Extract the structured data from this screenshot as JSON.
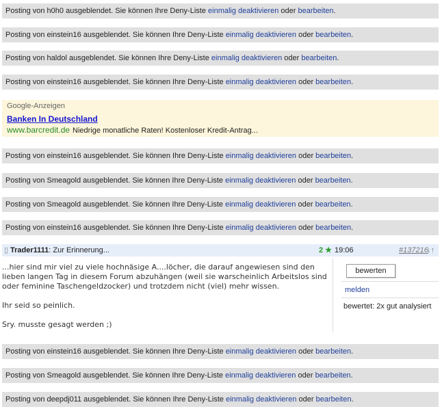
{
  "text": {
    "prefix": "Posting von ",
    "mid": " ausgeblendet. Sie können Ihre Deny-Liste ",
    "link1": "einmalig deaktivieren",
    "or": " oder ",
    "link2": "bearbeiten",
    "end": "."
  },
  "hidden_top": [
    "h0h0",
    "einstein16",
    "haldol",
    "einstein16"
  ],
  "ad": {
    "label": "Google-Anzeigen",
    "title": "Banken In Deutschland",
    "url": "www.barcredit.de",
    "desc": "Niedrige monatliche Raten! Kostenloser Kredit-Antrag..."
  },
  "hidden_mid": [
    "einstein16",
    "Smeagold",
    "Smeagold",
    "einstein16"
  ],
  "post": {
    "user": "Trader1111",
    "subject": ": Zur Erinnerung...",
    "stars": "2 ★",
    "time": "19:06",
    "number": "#137216",
    "arrows": "↓↑",
    "body": [
      "...hier sind mir viel zu viele hochnäsige A....löcher, die darauf angewiesen sind den lieben langen Tag in diesem Forum abzuhängen (weil sie warscheinlich Arbeitslos sind oder feminine Taschengeldzocker) und trotzdem nicht (viel) mehr wissen.",
      "Ihr seid so peinlich.",
      "Sry. musste gesagt werden ;)"
    ],
    "rate_button": "bewerten",
    "report_link": "melden",
    "rated": "bewertet: 2x gut analysiert"
  },
  "hidden_bottom": [
    "einstein16",
    "Smeagold",
    "deepdj011"
  ]
}
